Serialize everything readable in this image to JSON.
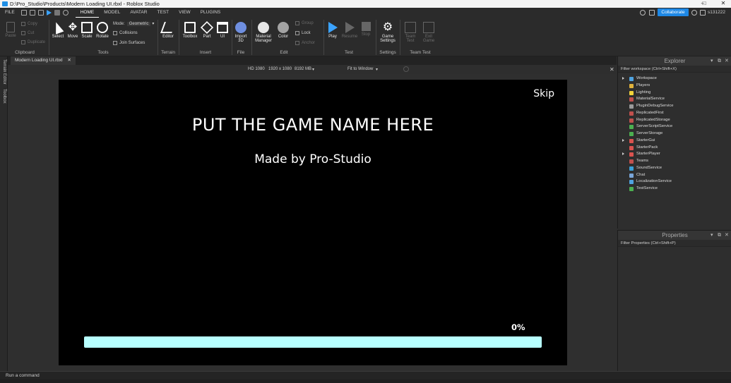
{
  "window": {
    "title": "D:\\Pro_Studio\\Products\\Modern Loading UI.rbxl - Roblox Studio",
    "controls": [
      "–",
      "□",
      "✕"
    ]
  },
  "menubar": {
    "file": "FILE",
    "tabs": [
      "HOME",
      "MODEL",
      "AVATAR",
      "TEST",
      "VIEW",
      "PLUGINS"
    ],
    "collaborate": "Collaborate",
    "user": "s131222"
  },
  "ribbon": {
    "clipboard": {
      "paste": "Paste",
      "copy": "Copy",
      "cut": "Cut",
      "duplicate": "Duplicate",
      "label": "Clipboard"
    },
    "tools": {
      "select": "Select",
      "move": "Move",
      "scale": "Scale",
      "rotate": "Rotate",
      "mode_label": "Mode:",
      "mode_value": "Geometric",
      "collisions": "Collisions",
      "join_surfaces": "Join Surfaces",
      "label": "Tools"
    },
    "terrain": {
      "editor": "Editor",
      "label": "Terrain"
    },
    "insert": {
      "toolbox": "Toolbox",
      "part": "Part",
      "ui": "UI",
      "label": "Insert"
    },
    "file": {
      "import": "Import",
      "import2": "3D",
      "label": "File"
    },
    "edit": {
      "material": "Material",
      "material2": "Manager",
      "color": "Color",
      "group": "Group",
      "lock": "Lock",
      "anchor": "Anchor",
      "label": "Edit"
    },
    "test": {
      "play": "Play",
      "resume": "Resume",
      "stop": "Stop",
      "label": "Test"
    },
    "settings": {
      "game": "Game",
      "game2": "Settings",
      "label": "Settings"
    },
    "teamtest": {
      "team": "Team",
      "team2": "Test",
      "exit": "Exit",
      "exit2": "Game",
      "label": "Team Test"
    }
  },
  "left_strip": {
    "terrain_editor": "Terrain Editor",
    "toolbox": "Toolbox"
  },
  "document": {
    "tab_label": "Modern Loading UI.rbxl",
    "close": "✕"
  },
  "viewport_bar": {
    "resolution": "HD 1080",
    "size": "1920 x 1080",
    "memory": "8192 MB",
    "fit": "Fit to Window",
    "close": "✕"
  },
  "game_ui": {
    "skip": "Skip",
    "title": "PUT THE GAME NAME HERE",
    "subtitle": "Made by Pro-Studio",
    "percent": "0%",
    "progress": 0
  },
  "explorer": {
    "title": "Explorer",
    "filter": "Filter workspace (Ctrl+Shift+X)",
    "items": [
      {
        "label": "Workspace",
        "expandable": true,
        "color": "#4fa3e0"
      },
      {
        "label": "Players",
        "expandable": false,
        "color": "#e0b23c"
      },
      {
        "label": "Lighting",
        "expandable": false,
        "color": "#f2d33a"
      },
      {
        "label": "MaterialService",
        "expandable": false,
        "color": "#c0504d"
      },
      {
        "label": "PluginDebugService",
        "expandable": false,
        "color": "#9a9a9a"
      },
      {
        "label": "ReplicatedFirst",
        "expandable": false,
        "color": "#c0504d"
      },
      {
        "label": "ReplicatedStorage",
        "expandable": false,
        "color": "#c0504d"
      },
      {
        "label": "ServerScriptService",
        "expandable": false,
        "color": "#4caf50"
      },
      {
        "label": "ServerStorage",
        "expandable": false,
        "color": "#4caf50"
      },
      {
        "label": "StarterGui",
        "expandable": true,
        "color": "#d9534f"
      },
      {
        "label": "StarterPack",
        "expandable": false,
        "color": "#d9534f"
      },
      {
        "label": "StarterPlayer",
        "expandable": true,
        "color": "#d9534f"
      },
      {
        "label": "Teams",
        "expandable": false,
        "color": "#c0504d"
      },
      {
        "label": "SoundService",
        "expandable": false,
        "color": "#3aa0d8"
      },
      {
        "label": "Chat",
        "expandable": false,
        "color": "#7aa6d8"
      },
      {
        "label": "LocalizationService",
        "expandable": false,
        "color": "#4fa3e0"
      },
      {
        "label": "TestService",
        "expandable": false,
        "color": "#4caf50"
      }
    ]
  },
  "properties": {
    "title": "Properties",
    "filter": "Filter Properties (Ctrl+Shift+P)"
  },
  "command_bar": {
    "placeholder": "Run a command"
  }
}
